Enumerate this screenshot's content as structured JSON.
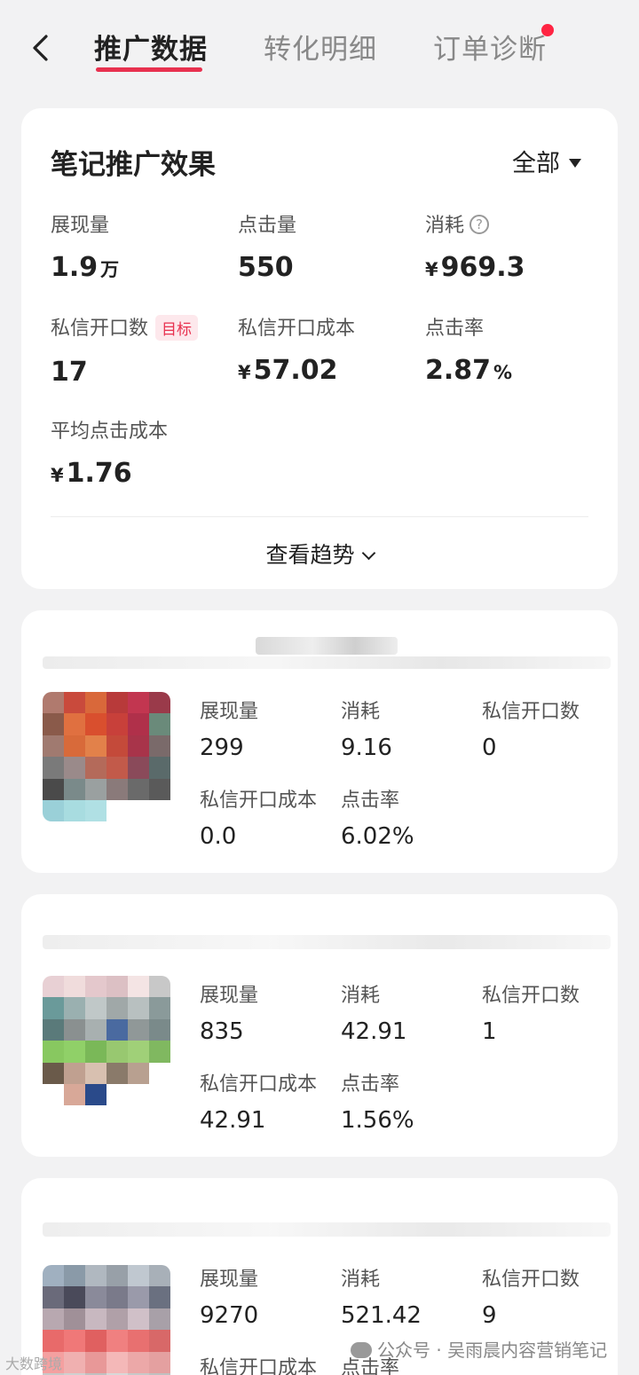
{
  "header": {
    "back_icon": "chevron-left-icon",
    "tabs": [
      {
        "label": "推广数据",
        "active": true
      },
      {
        "label": "转化明细",
        "active": false
      },
      {
        "label": "订单诊断",
        "active": false,
        "has_dot": true
      }
    ],
    "accent_color": "#e8314f"
  },
  "summary": {
    "title": "笔记推广效果",
    "filter_label": "全部",
    "metrics": [
      {
        "label": "展现量",
        "value": "1.9",
        "unit": "万"
      },
      {
        "label": "点击量",
        "value": "550"
      },
      {
        "label": "消耗",
        "currency": "¥",
        "value": "969.3",
        "help": "?"
      },
      {
        "label": "私信开口数",
        "badge": "目标",
        "value": "17"
      },
      {
        "label": "私信开口成本",
        "currency": "¥",
        "value": "57.02"
      },
      {
        "label": "点击率",
        "value": "2.87",
        "unit": "%"
      },
      {
        "label": "平均点击成本",
        "currency": "¥",
        "value": "1.76"
      }
    ],
    "trend_label": "查看趋势"
  },
  "notes": [
    {
      "stats": [
        {
          "label": "展现量",
          "value": "299"
        },
        {
          "label": "消耗",
          "value": "9.16"
        },
        {
          "label": "私信开口数",
          "value": "0"
        },
        {
          "label": "私信开口成本",
          "value": "0.0"
        },
        {
          "label": "点击率",
          "value": "6.02%"
        }
      ]
    },
    {
      "stats": [
        {
          "label": "展现量",
          "value": "835"
        },
        {
          "label": "消耗",
          "value": "42.91"
        },
        {
          "label": "私信开口数",
          "value": "1"
        },
        {
          "label": "私信开口成本",
          "value": "42.91"
        },
        {
          "label": "点击率",
          "value": "1.56%"
        }
      ]
    },
    {
      "stats": [
        {
          "label": "展现量",
          "value": "9270"
        },
        {
          "label": "消耗",
          "value": "521.42"
        },
        {
          "label": "私信开口数",
          "value": "9"
        },
        {
          "label": "私信开口成本",
          "value": ""
        },
        {
          "label": "点击率",
          "value": ""
        }
      ]
    }
  ],
  "watermark": {
    "right_text": "公众号 · 吴雨晨内容营销笔记",
    "left_text": "大数跨境"
  }
}
